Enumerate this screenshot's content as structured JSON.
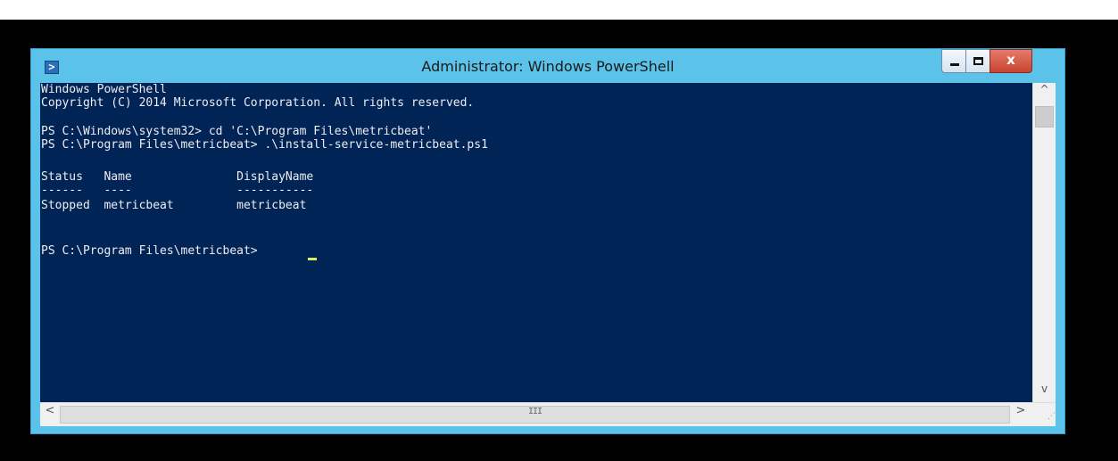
{
  "window": {
    "title": "Administrator: Windows PowerShell",
    "icon": "powershell-icon",
    "controls": {
      "minimize_icon": "minimize-icon",
      "maximize_icon": "maximize-icon",
      "close_glyph": "x"
    }
  },
  "console": {
    "lines": [
      "Windows PowerShell",
      "Copyright (C) 2014 Microsoft Corporation. All rights reserved.",
      "",
      "PS C:\\Windows\\system32> cd 'C:\\Program Files\\metricbeat'",
      "PS C:\\Program Files\\metricbeat> .\\install-service-metricbeat.ps1",
      "",
      "Status   Name               DisplayName",
      "------   ----               -----------",
      "Stopped  metricbeat         metricbeat",
      "",
      "",
      "PS C:\\Program Files\\metricbeat> "
    ],
    "background_color": "#012456",
    "text_color": "#eeedf0",
    "cursor_color": "#d8f066"
  },
  "scrollbars": {
    "up_arrow": "^",
    "down_arrow": "v",
    "left_arrow": "<",
    "right_arrow": ">",
    "grip": "III"
  },
  "colors": {
    "window_frame": "#5bc3ea",
    "close_button": "#c74431"
  }
}
